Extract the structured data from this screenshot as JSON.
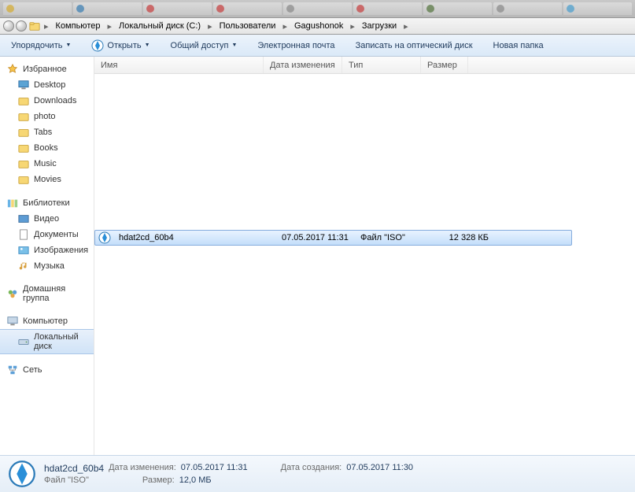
{
  "breadcrumb": [
    "Компьютер",
    "Локальный диск (C:)",
    "Пользователи",
    "Gagushonok",
    "Загрузки"
  ],
  "toolbar": {
    "organize": "Упорядочить",
    "open": "Открыть",
    "share": "Общий доступ",
    "email": "Электронная почта",
    "burn": "Записать на оптический диск",
    "newfolder": "Новая папка"
  },
  "sidebar": {
    "favorites": {
      "label": "Избранное",
      "items": [
        "Desktop",
        "Downloads",
        "photo",
        "Tabs",
        "Books",
        "Music",
        "Movies"
      ]
    },
    "libraries": {
      "label": "Библиотеки",
      "items": [
        "Видео",
        "Документы",
        "Изображения",
        "Музыка"
      ]
    },
    "homegroup": {
      "label": "Домашняя группа"
    },
    "computer": {
      "label": "Компьютер",
      "items": [
        "Локальный диск"
      ]
    },
    "network": {
      "label": "Сеть"
    }
  },
  "columns": {
    "name": "Имя",
    "date": "Дата изменения",
    "type": "Тип",
    "size": "Размер"
  },
  "file": {
    "name": "hdat2cd_60b4",
    "date": "07.05.2017 11:31",
    "type": "Файл \"ISO\"",
    "size": "12 328 КБ"
  },
  "details": {
    "name": "hdat2cd_60b4",
    "typeLabel": "Файл \"ISO\"",
    "modLabel": "Дата изменения:",
    "modVal": "07.05.2017 11:31",
    "createdLabel": "Дата создания:",
    "createdVal": "07.05.2017 11:30",
    "sizeLabel": "Размер:",
    "sizeVal": "12,0 МБ"
  }
}
